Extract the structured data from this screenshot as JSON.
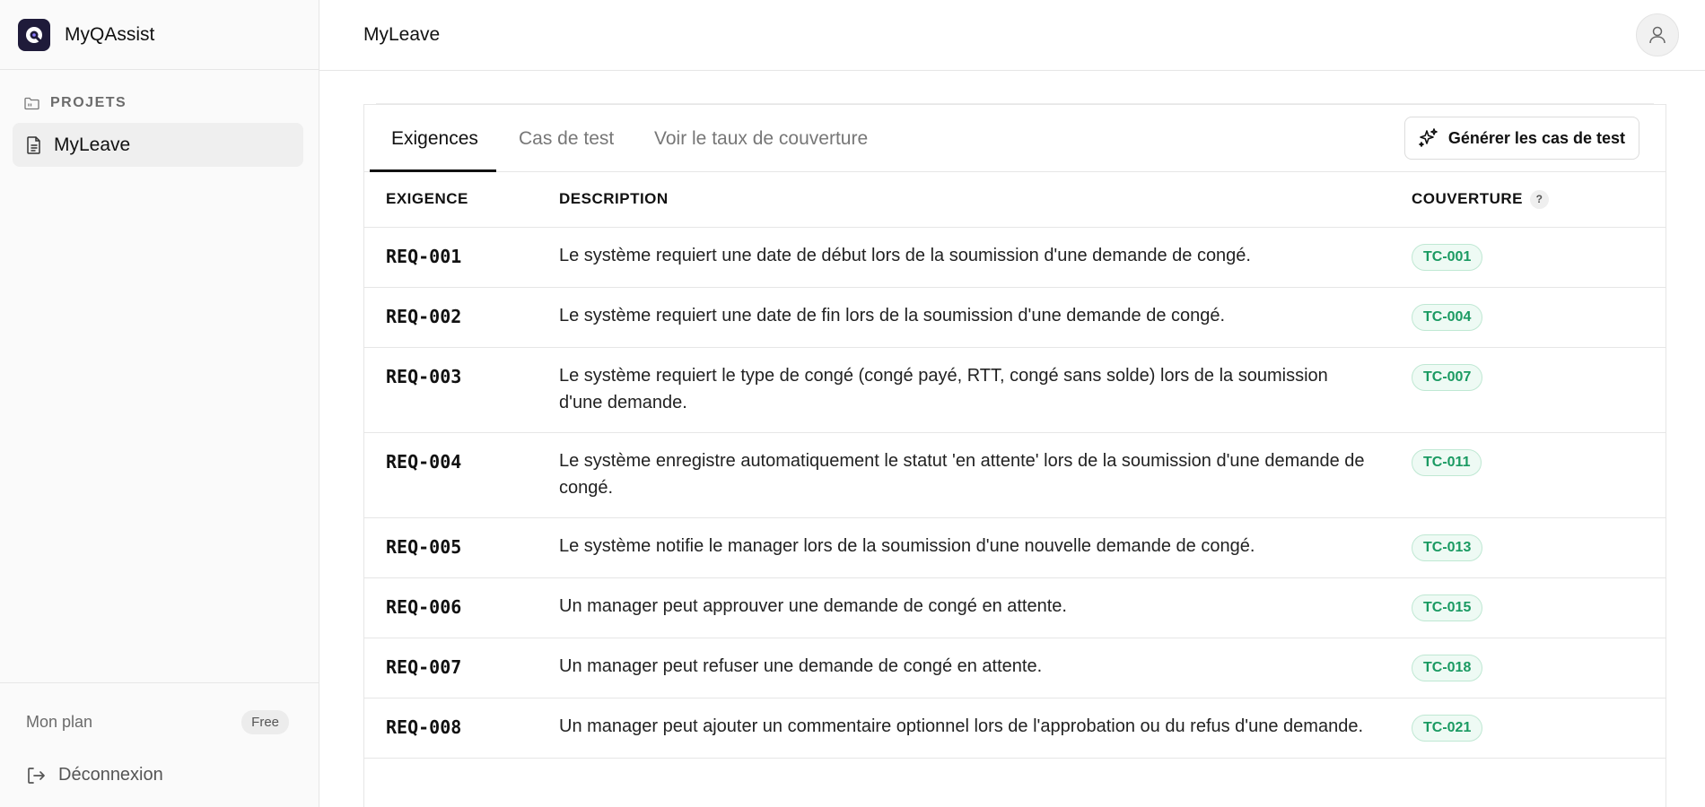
{
  "app": {
    "name": "MyQAssist",
    "accent_color": "#1f1b3a"
  },
  "sidebar": {
    "section_label": "PROJETS",
    "projects": [
      {
        "label": "MyLeave",
        "icon": "document-icon"
      }
    ],
    "plan": {
      "label": "Mon plan",
      "badge": "Free"
    },
    "logout_label": "Déconnexion"
  },
  "header": {
    "title": "MyLeave",
    "user_icon": "user-icon"
  },
  "tabs": [
    {
      "label": "Exigences",
      "active": true
    },
    {
      "label": "Cas de test",
      "active": false
    },
    {
      "label": "Voir le taux de couverture",
      "active": false
    }
  ],
  "actions": {
    "generate_label": "Générer les cas de test",
    "generate_icon": "sparkles-icon"
  },
  "table": {
    "columns": [
      "EXIGENCE",
      "DESCRIPTION",
      "COUVERTURE"
    ],
    "coverage_help": "?",
    "rows": [
      {
        "id": "REQ-001",
        "description": "Le système requiert une date de début lors de la soumission d'une demande de congé.",
        "coverage": "TC-001"
      },
      {
        "id": "REQ-002",
        "description": "Le système requiert une date de fin lors de la soumission d'une demande de congé.",
        "coverage": "TC-004"
      },
      {
        "id": "REQ-003",
        "description": "Le système requiert le type de congé (congé payé, RTT, congé sans solde) lors de la soumission d'une demande.",
        "coverage": "TC-007"
      },
      {
        "id": "REQ-004",
        "description": "Le système enregistre automatiquement le statut 'en attente' lors de la soumission d'une demande de congé.",
        "coverage": "TC-011"
      },
      {
        "id": "REQ-005",
        "description": "Le système notifie le manager lors de la soumission d'une nouvelle demande de congé.",
        "coverage": "TC-013"
      },
      {
        "id": "REQ-006",
        "description": "Un manager peut approuver une demande de congé en attente.",
        "coverage": "TC-015"
      },
      {
        "id": "REQ-007",
        "description": "Un manager peut refuser une demande de congé en attente.",
        "coverage": "TC-018"
      },
      {
        "id": "REQ-008",
        "description": "Un manager peut ajouter un commentaire optionnel lors de l'approbation ou du refus d'une demande.",
        "coverage": "TC-021"
      }
    ]
  }
}
